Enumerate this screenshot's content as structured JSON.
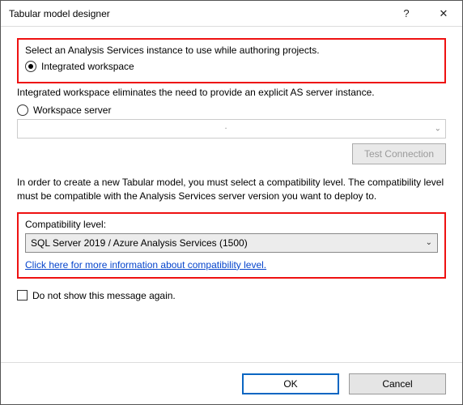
{
  "titlebar": {
    "title": "Tabular model designer",
    "help_glyph": "?",
    "close_glyph": "✕"
  },
  "top": {
    "instruction": "Select an Analysis Services instance to use while authoring projects.",
    "radio_integrated": "Integrated workspace"
  },
  "workspace": {
    "note": "Integrated workspace eliminates the need to provide an explicit AS server instance.",
    "radio_server": "Workspace server",
    "server_value": "",
    "server_dot": ".",
    "test_connection": "Test Connection"
  },
  "compat": {
    "paragraph": "In order to create a new Tabular model, you must select a compatibility level. The compatibility level must be compatible with the Analysis Services server version you want to deploy to.",
    "label": "Compatibility level:",
    "selected": "SQL Server 2019 / Azure Analysis Services (1500)",
    "link": "Click here for more information about compatibility level."
  },
  "checkbox": {
    "label": "Do not show this message again."
  },
  "footer": {
    "ok": "OK",
    "cancel": "Cancel"
  }
}
